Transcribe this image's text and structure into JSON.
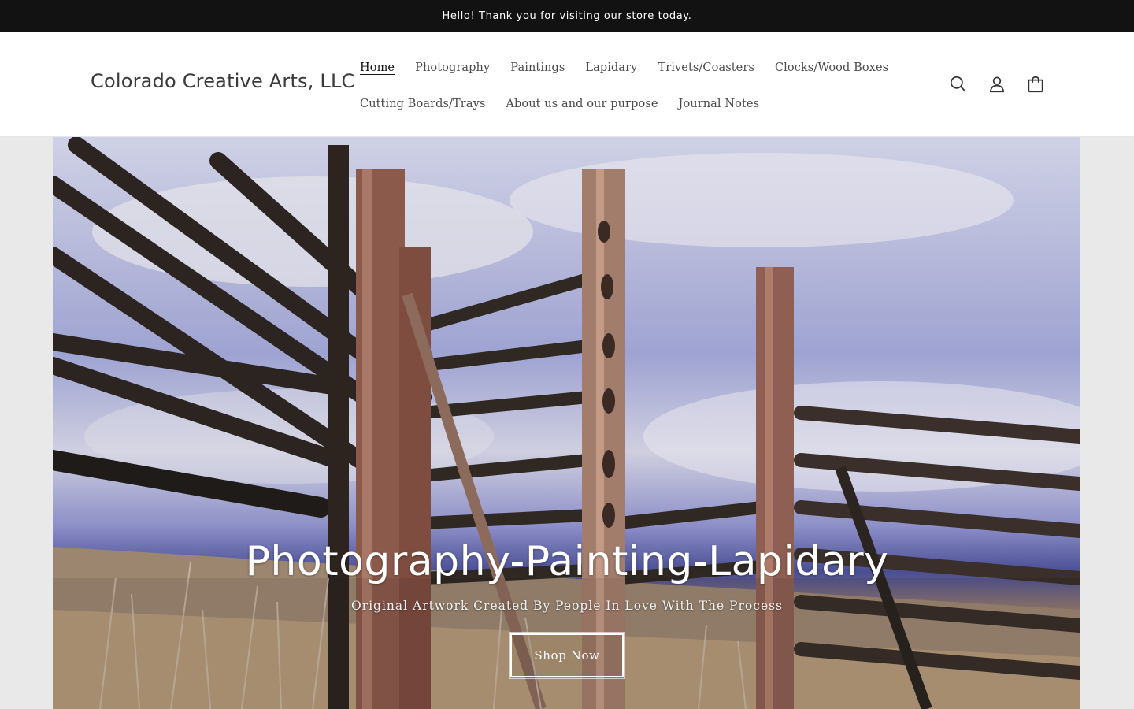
{
  "announcement": {
    "text": "Hello! Thank you for visiting our store today."
  },
  "header": {
    "logo": "Colorado Creative Arts, LLC",
    "nav_row_1": [
      "Home",
      "Photography",
      "Paintings",
      "Lapidary",
      "Trivets/Coasters",
      "Clocks/Wood Boxes"
    ],
    "nav_row_2": [
      "Cutting Boards/Trays",
      "About us and our purpose",
      "Journal Notes"
    ],
    "active_nav": "Home",
    "icons": [
      "search-icon",
      "account-icon",
      "cart-icon"
    ]
  },
  "hero": {
    "title": "Photography-Painting-Lapidary",
    "subtitle": "Original Artwork Created By People In Love With The Process",
    "button_label": "Shop Now",
    "image_description_icon": "fence-landscape-photo"
  },
  "colors": {
    "announcement_bg": "#121212",
    "header_bg": "#ffffff",
    "text": "#333333",
    "hero_page_bg": "#e9e9e9"
  }
}
